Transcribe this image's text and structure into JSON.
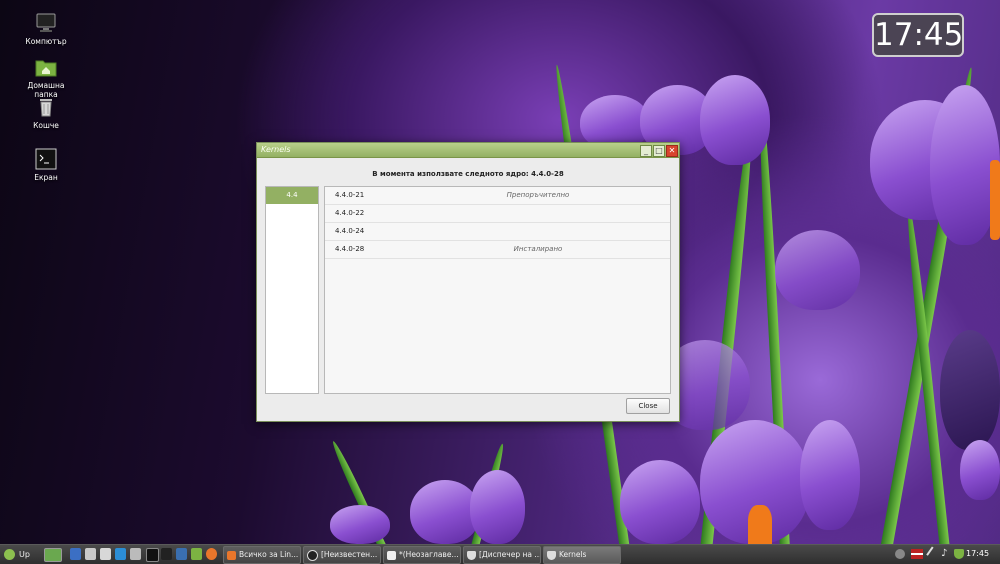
{
  "desktop": {
    "icons": [
      {
        "label": "Компютър",
        "icon": "computer-icon"
      },
      {
        "label": "Домашна папка",
        "icon": "home-folder-icon"
      },
      {
        "label": "Кошче",
        "icon": "trash-icon"
      },
      {
        "label": "Екран",
        "icon": "screen-icon"
      }
    ],
    "clock_widget": "17:45"
  },
  "window": {
    "title": "Kernels",
    "minimize_glyph": "_",
    "maximize_glyph": "□",
    "close_glyph": "✕",
    "info_text": "В момента използвате следното ядро: 4.4.0-28",
    "series": [
      "4.4"
    ],
    "kernels": [
      {
        "version": "4.4.0-21",
        "status": "Препоръчително"
      },
      {
        "version": "4.4.0-22",
        "status": ""
      },
      {
        "version": "4.4.0-24",
        "status": ""
      },
      {
        "version": "4.4.0-28",
        "status": "Инсталирано"
      }
    ],
    "close_button": "Close"
  },
  "taskbar": {
    "menu_label": "Up",
    "tasks": [
      {
        "label": "Всичко за Lin...",
        "icon": "firefox-icon"
      },
      {
        "label": "[Неизвестен...",
        "icon": "media-icon"
      },
      {
        "label": "*(Неозаглаве...",
        "icon": "text-editor-icon"
      },
      {
        "label": "[Диспечер на ...",
        "icon": "shield-icon"
      },
      {
        "label": "Kernels",
        "icon": "shield-icon"
      }
    ],
    "clock": "17:45"
  },
  "colors": {
    "accent": "#93b063",
    "close": "#d8442e",
    "taskbar": "#3a3a3a"
  }
}
